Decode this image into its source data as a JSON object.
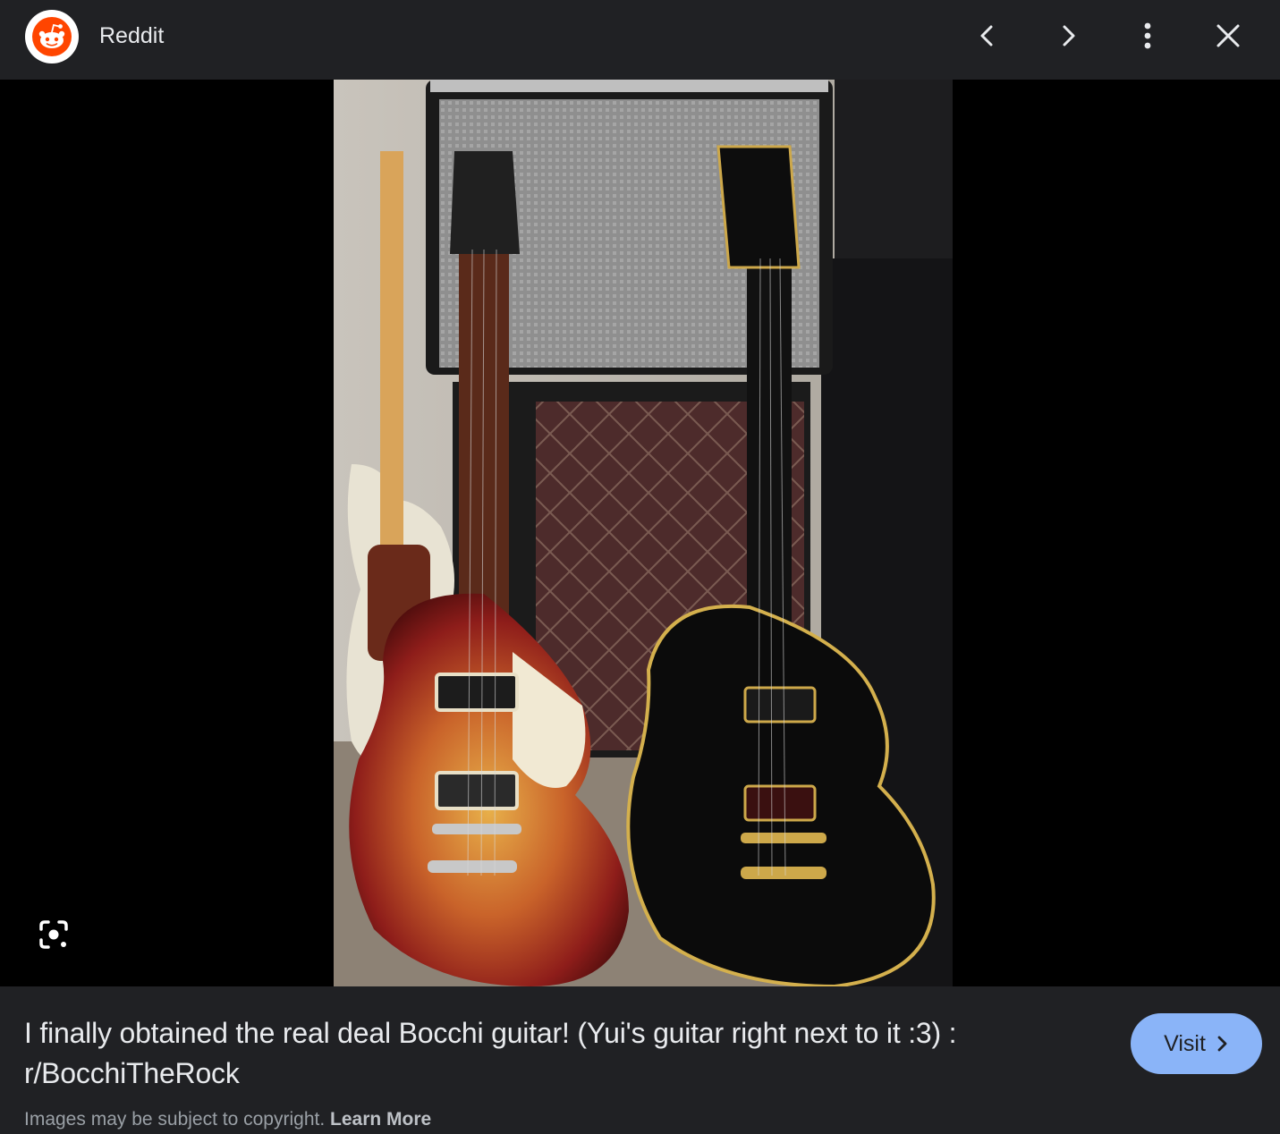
{
  "header": {
    "site_name": "Reddit",
    "logo_icon": "reddit-logo-icon",
    "controls": [
      {
        "name": "previous-button",
        "icon": "chevron-left-icon"
      },
      {
        "name": "next-button",
        "icon": "chevron-right-icon"
      },
      {
        "name": "more-options-button",
        "icon": "more-vert-icon"
      },
      {
        "name": "close-button",
        "icon": "close-icon"
      }
    ]
  },
  "image": {
    "subject": "Two Gibson Les Paul guitars (cherry sunburst and black custom) and an offset guitar in front of a Reverb Amp and speaker cabinet",
    "visual_search_icon": "lens-icon"
  },
  "info": {
    "title": "I finally obtained the real deal Bocchi guitar! (Yui's guitar right next to it :3) : r/BocchiTheRock",
    "visit_label": "Visit",
    "copyright_text": "Images may be subject to copyright.",
    "learn_more_label": "Learn More"
  },
  "colors": {
    "background": "#202124",
    "stage": "#000000",
    "accent": "#8ab4f8",
    "reddit_orange": "#ff4500"
  }
}
